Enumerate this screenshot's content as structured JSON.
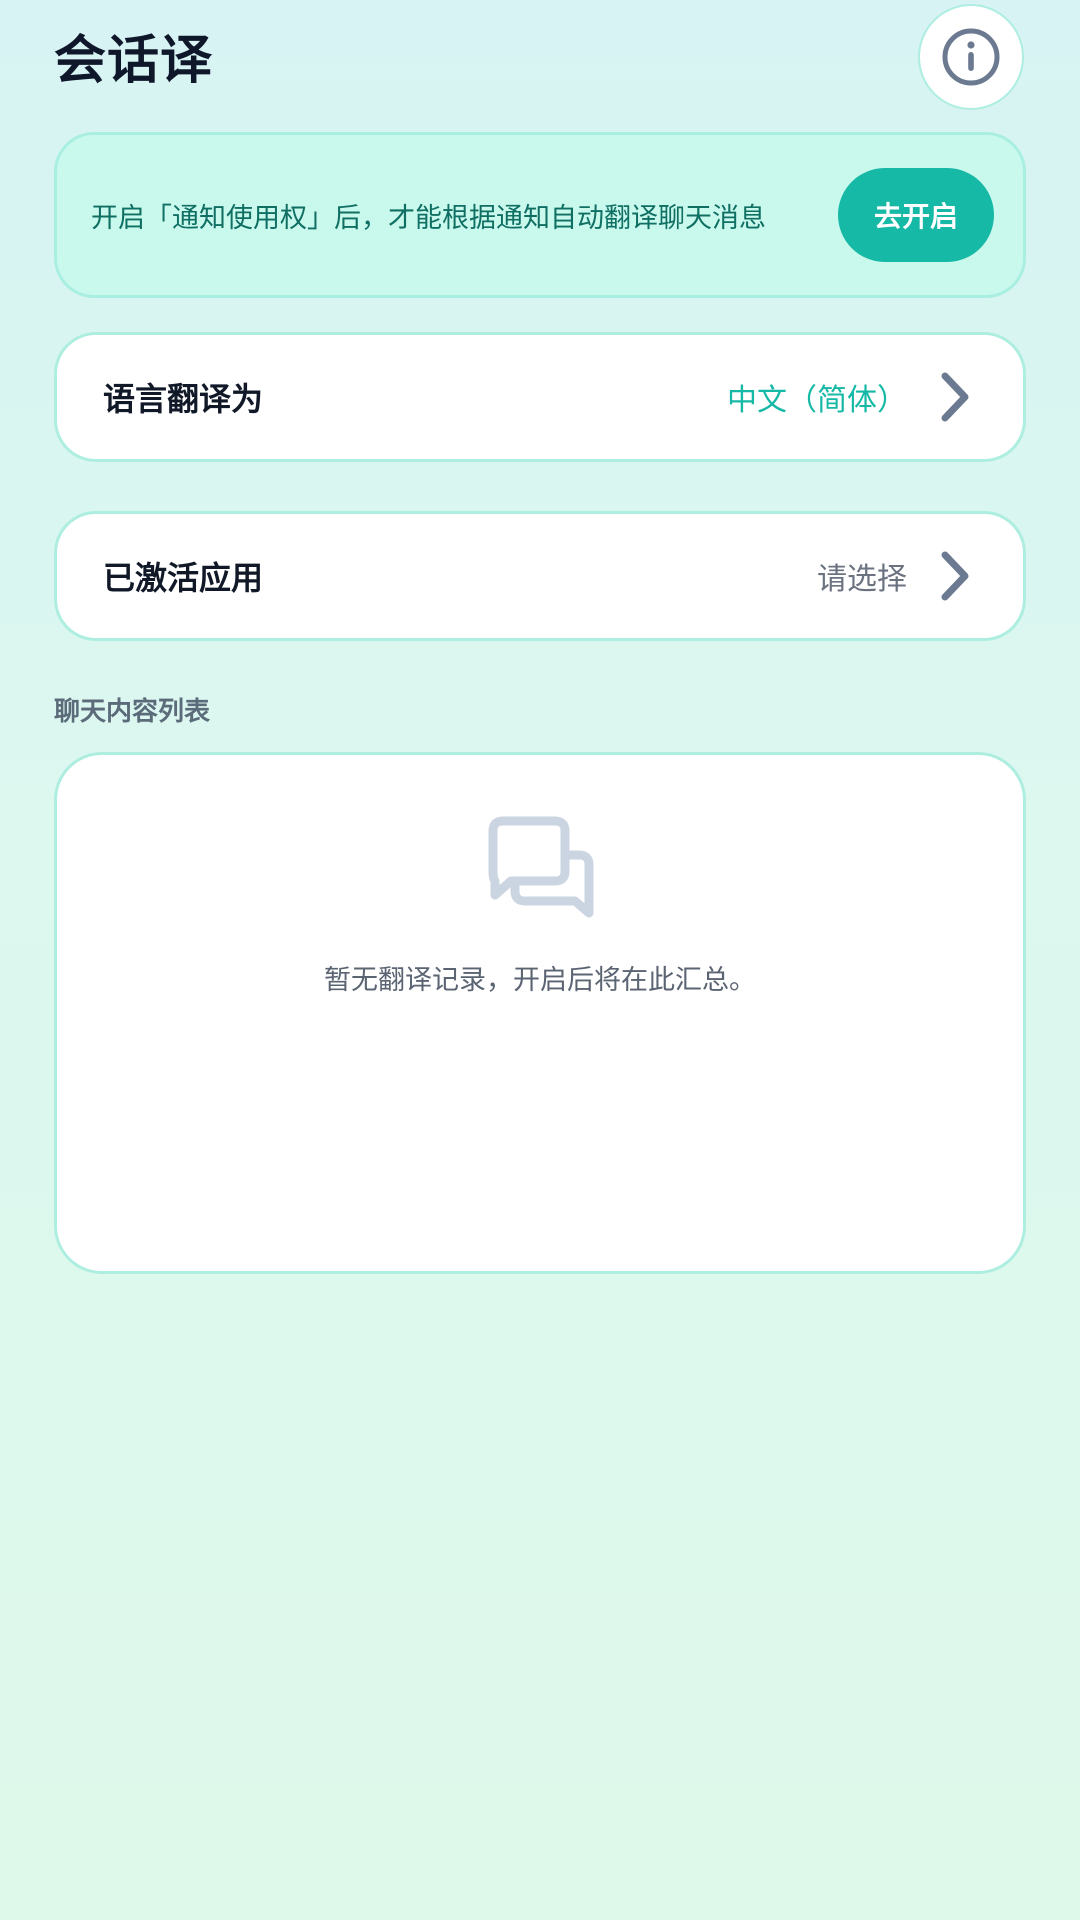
{
  "header": {
    "title": "会话译",
    "info_icon": "info-icon"
  },
  "banner": {
    "text": "开启「通知使用权」后，才能根据通知自动翻译聊天消息",
    "button_label": "去开启"
  },
  "settings": {
    "language": {
      "label": "语言翻译为",
      "value": "中文（简体）",
      "value_color": "#16b8a6"
    },
    "apps": {
      "label": "已激活应用",
      "value": "请选择",
      "value_color": "#6b7280"
    }
  },
  "chat_list": {
    "section_title": "聊天内容列表",
    "empty_icon": "chat-bubbles-icon",
    "empty_text": "暂无翻译记录，开启后将在此汇总。"
  },
  "colors": {
    "accent": "#16b8a6",
    "border": "#aeeee0",
    "banner_bg": "#c9f8ed"
  }
}
